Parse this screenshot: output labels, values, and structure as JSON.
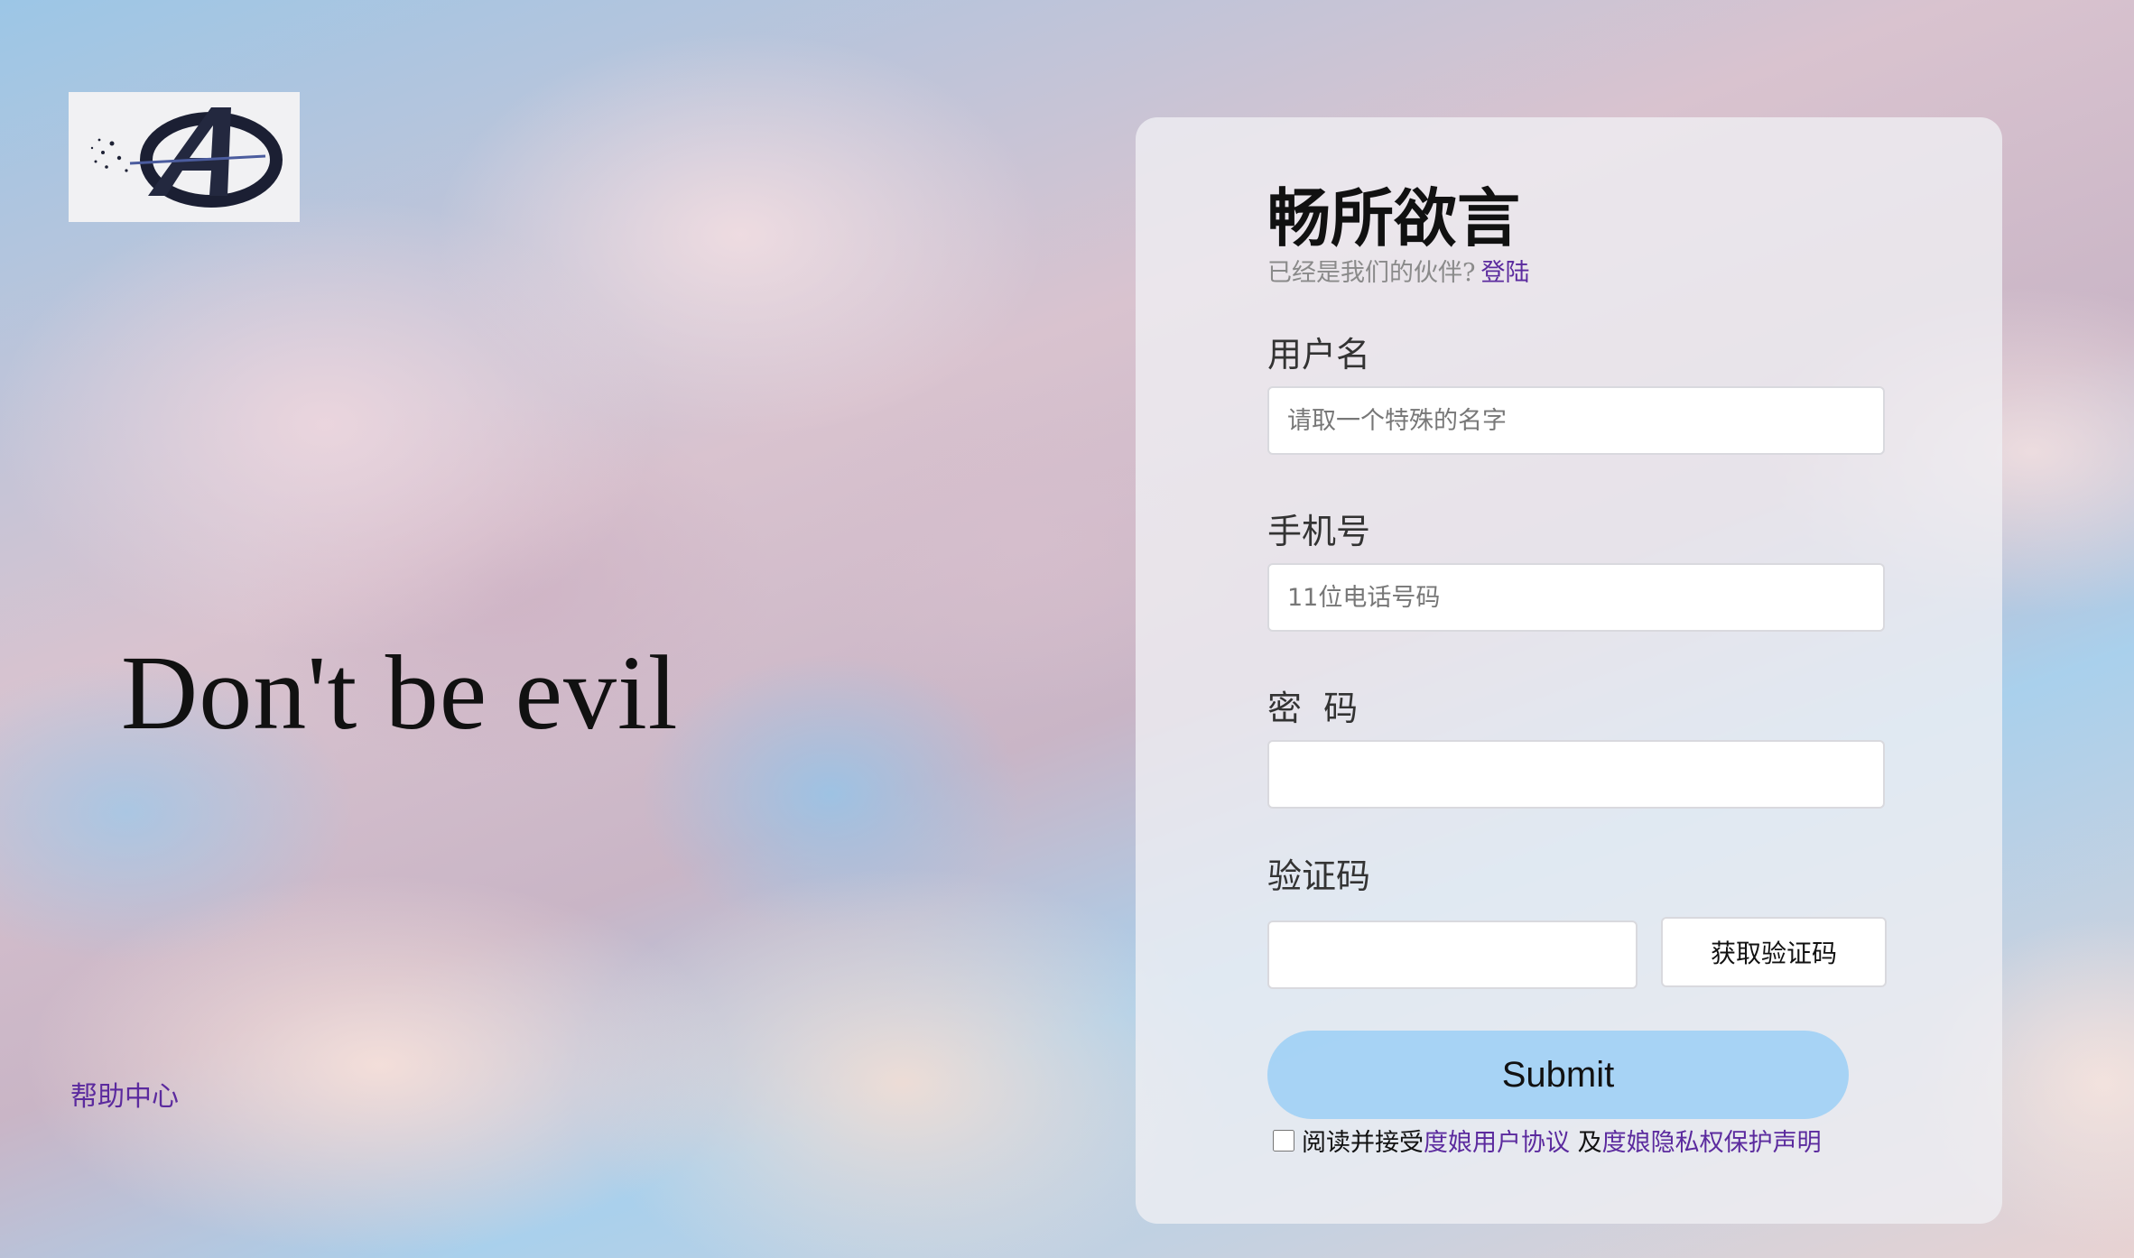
{
  "left": {
    "logo_text": "A",
    "slogan": "Don't be evil",
    "help_link": "帮助中心"
  },
  "form": {
    "title": "畅所欲言",
    "subtitle_prefix": "已经是我们的伙伴?",
    "login_link": "登陆",
    "username_label": "用户名",
    "username_placeholder": "请取一个特殊的名字",
    "phone_label": "手机号",
    "phone_placeholder": "11位电话号码",
    "password_label": "密  码",
    "code_label": "验证码",
    "get_code_button": "获取验证码",
    "submit_button": "Submit",
    "agree_prefix": "阅读并接受",
    "user_agreement_link": "度娘用户协议",
    "agree_middle": " 及",
    "privacy_link": "度娘隐私权保护声明"
  },
  "colors": {
    "link": "#5b2a9e",
    "submit_bg": "#a0d0f5"
  }
}
